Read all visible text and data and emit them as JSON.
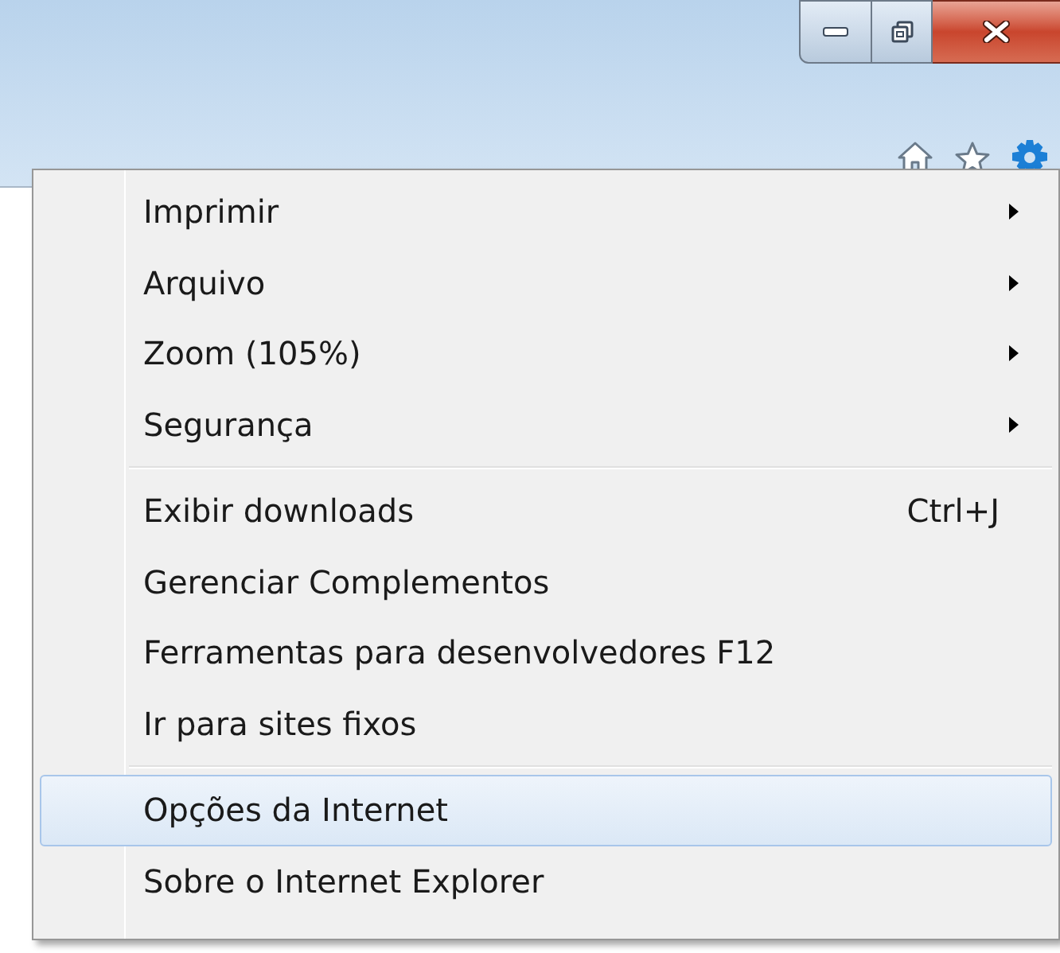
{
  "window_controls": [
    {
      "kind": "minimize"
    },
    {
      "kind": "restore"
    },
    {
      "kind": "close"
    }
  ],
  "toolbar": [
    {
      "kind": "home"
    },
    {
      "kind": "star"
    },
    {
      "kind": "gear"
    }
  ],
  "menu": {
    "groups": [
      {
        "items": [
          {
            "label": "Imprimir",
            "submenu": true,
            "selected": false
          },
          {
            "label": "Arquivo",
            "submenu": true,
            "selected": false
          },
          {
            "label": "Zoom (105%)",
            "submenu": true,
            "selected": false
          },
          {
            "label": "Segurança",
            "submenu": true,
            "selected": false
          }
        ]
      },
      {
        "items": [
          {
            "label": "Exibir downloads",
            "shortcut": "Ctrl+J",
            "submenu": false,
            "selected": false
          },
          {
            "label": "Gerenciar Complementos",
            "submenu": false,
            "selected": false
          },
          {
            "label": "Ferramentas para desenvolvedores F12",
            "submenu": false,
            "selected": false
          },
          {
            "label": "Ir para sites fixos",
            "submenu": false,
            "selected": false
          }
        ]
      },
      {
        "items": [
          {
            "label": "Opções da Internet",
            "submenu": false,
            "selected": true
          },
          {
            "label": "Sobre o Internet Explorer",
            "submenu": false,
            "selected": false
          }
        ]
      }
    ]
  }
}
